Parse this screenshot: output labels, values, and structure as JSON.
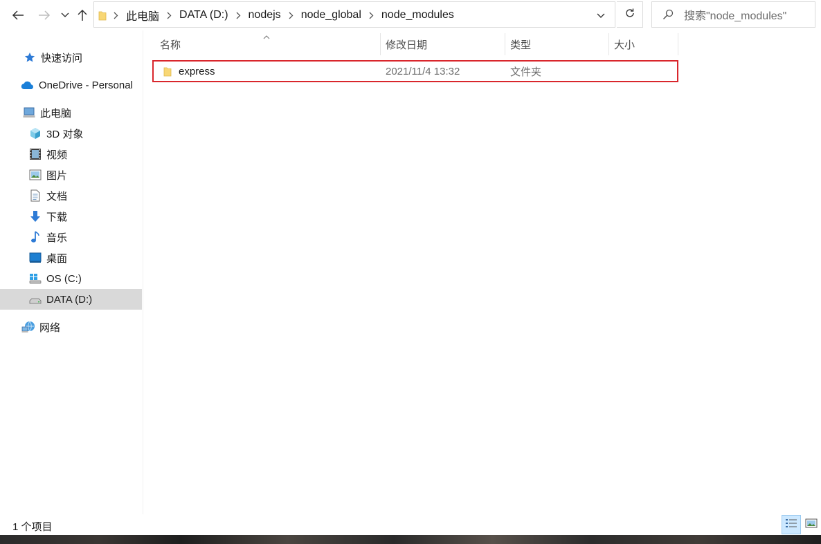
{
  "nav": {
    "back_icon": "back-arrow-icon",
    "forward_icon": "forward-arrow-icon",
    "history_icon": "chevron-down-icon",
    "up_icon": "up-arrow-icon"
  },
  "address_bar": {
    "breadcrumbs": [
      "此电脑",
      "DATA (D:)",
      "nodejs",
      "node_global",
      "node_modules"
    ]
  },
  "search": {
    "placeholder": "搜索\"node_modules\""
  },
  "sidebar": {
    "items": [
      {
        "label": "快速访问",
        "icon": "star-icon"
      },
      {
        "label": "OneDrive - Personal",
        "icon": "cloud-icon"
      },
      {
        "label": "此电脑",
        "icon": "computer-icon"
      },
      {
        "label": "3D 对象",
        "icon": "cube-icon"
      },
      {
        "label": "视频",
        "icon": "film-icon"
      },
      {
        "label": "图片",
        "icon": "picture-icon"
      },
      {
        "label": "文档",
        "icon": "document-icon"
      },
      {
        "label": "下载",
        "icon": "download-arrow-icon"
      },
      {
        "label": "音乐",
        "icon": "music-note-icon"
      },
      {
        "label": "桌面",
        "icon": "desktop-icon"
      },
      {
        "label": "OS (C:)",
        "icon": "windows-drive-icon"
      },
      {
        "label": "DATA (D:)",
        "icon": "drive-icon",
        "selected": true
      },
      {
        "label": "网络",
        "icon": "network-icon"
      }
    ]
  },
  "columns": {
    "name": "名称",
    "date": "修改日期",
    "type": "类型",
    "size": "大小"
  },
  "files": [
    {
      "name": "express",
      "date": "2021/11/4 13:32",
      "type": "文件夹",
      "size": ""
    }
  ],
  "status": {
    "item_count": "1 个项目"
  },
  "colors": {
    "selection_outline": "#d9262c",
    "selected_nav": "#d9d9d9",
    "folder": "#f8d775"
  }
}
